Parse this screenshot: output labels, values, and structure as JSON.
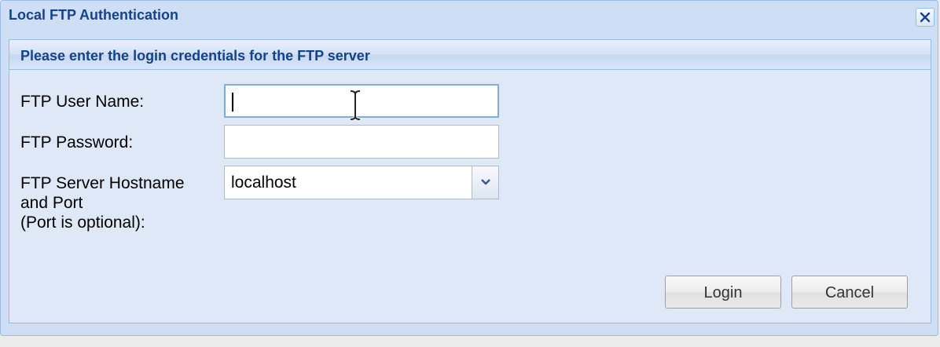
{
  "window": {
    "title": "Local FTP Authentication",
    "close_icon": "close-icon"
  },
  "panel": {
    "header": "Please enter the login credentials for the FTP server"
  },
  "form": {
    "username_label": "FTP User Name:",
    "username_value": "",
    "password_label": "FTP Password:",
    "password_value": "",
    "host_label_line1": "FTP Server Hostname",
    "host_label_line2": "and Port",
    "host_label_line3": "(Port is optional):",
    "host_value": "localhost",
    "host_dropdown_icon": "chevron-down-icon"
  },
  "buttons": {
    "login": "Login",
    "cancel": "Cancel"
  },
  "colors": {
    "title_text": "#15428b",
    "window_bg": "#cedff5",
    "panel_bg": "#dfe8f6",
    "border": "#99bbe8"
  }
}
